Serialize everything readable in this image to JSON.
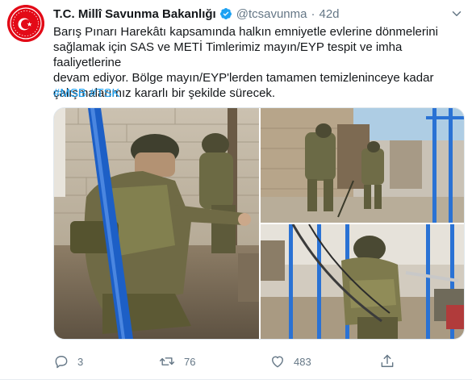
{
  "tweet": {
    "display_name": "T.C. Millî Savunma Bakanlığı",
    "handle": "@tcsavunma",
    "separator": "·",
    "time": "42d",
    "text_lines": [
      "Barış Pınarı Harekâtı kapsamında halkın emniyetle evlerine dönmelerini",
      "sağlamak için SAS ve METİ Timlerimiz mayın/EYP tespit ve imha faaliyetlerine",
      "devam ediyor. Bölge mayın/EYP'lerden tamamen temizleninceye kadar",
      "çalışmalarımız kararlı bir şekilde sürecek."
    ],
    "hashtags": [
      "#MSB",
      "#TSK"
    ],
    "counts": {
      "replies": "3",
      "retweets": "76",
      "likes": "483"
    }
  },
  "icons": {
    "avatar": "msb-emblem-icon",
    "verified": "verified-badge-icon",
    "more": "chevron-down-icon",
    "reply": "reply-icon",
    "retweet": "retweet-icon",
    "like": "heart-icon",
    "share": "share-icon"
  },
  "colors": {
    "accent": "#1da1f2",
    "muted": "#657786",
    "text": "#14171a",
    "emblem_red": "#e30a17"
  }
}
